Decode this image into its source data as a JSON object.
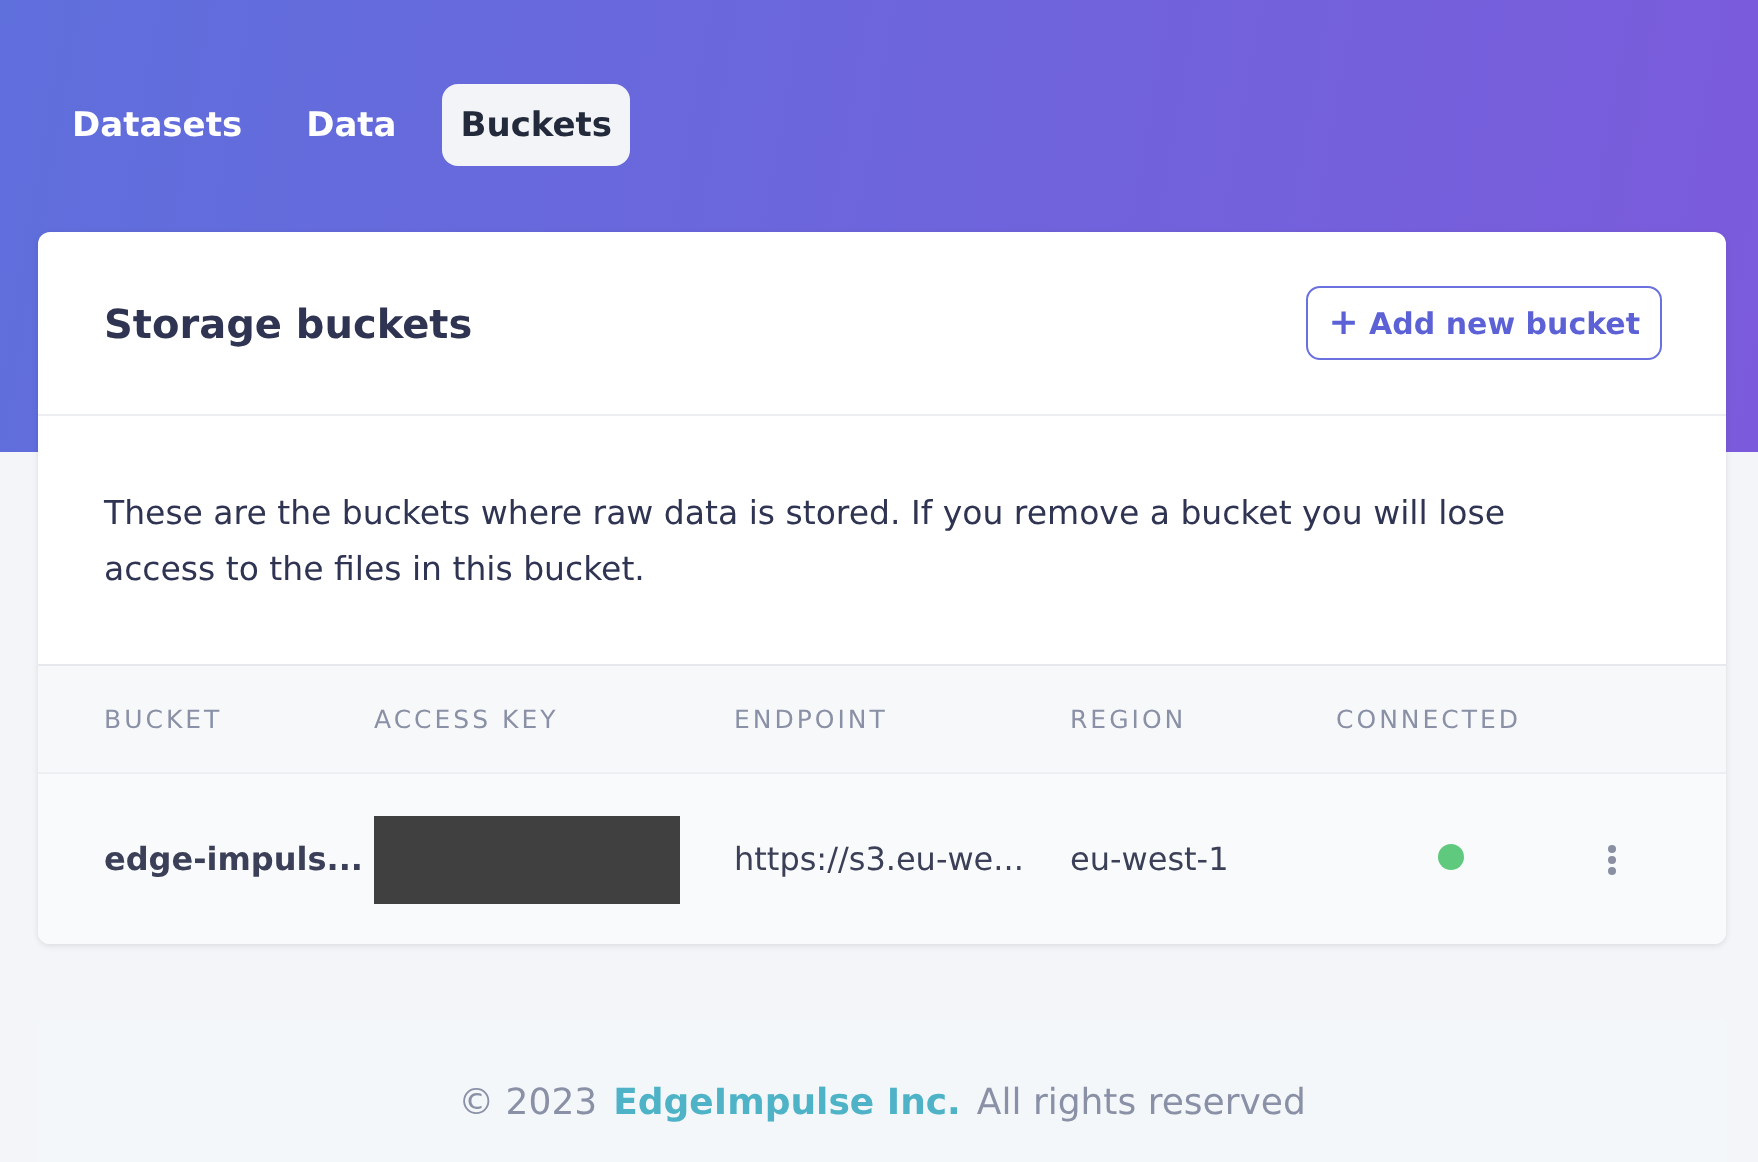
{
  "tabs": [
    {
      "label": "Datasets",
      "selected": false
    },
    {
      "label": "Data",
      "selected": false
    },
    {
      "label": "Buckets",
      "selected": true
    }
  ],
  "card": {
    "title": "Storage buckets",
    "add_button": {
      "icon": "+",
      "label": "Add new bucket"
    },
    "description": "These are the buckets where raw data is stored. If you remove a bucket you will lose access to the files in this bucket."
  },
  "table": {
    "columns": [
      "BUCKET",
      "ACCESS KEY",
      "ENDPOINT",
      "REGION",
      "CONNECTED"
    ],
    "rows": [
      {
        "cells": [
          {
            "kind": "name",
            "text": "edge-impuls..."
          },
          {
            "kind": "redacted"
          },
          {
            "kind": "text",
            "text": "https://s3.eu-we..."
          },
          {
            "kind": "text",
            "text": "eu-west-1"
          },
          {
            "kind": "status",
            "color": "#5fca7d"
          }
        ]
      }
    ]
  },
  "footer": {
    "copyright": "© 2023",
    "company": "EdgeImpulse Inc.",
    "rights": "All rights reserved"
  }
}
